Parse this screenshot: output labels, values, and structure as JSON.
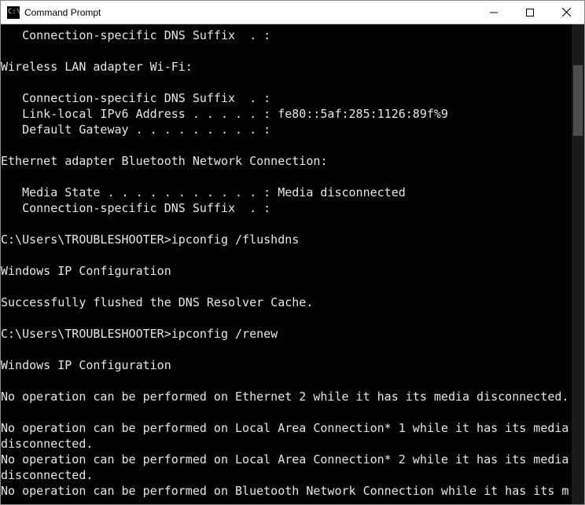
{
  "window": {
    "title": "Command Prompt"
  },
  "terminal": {
    "lines": [
      "   Connection-specific DNS Suffix  . :",
      "",
      "Wireless LAN adapter Wi-Fi:",
      "",
      "   Connection-specific DNS Suffix  . :",
      "   Link-local IPv6 Address . . . . . : fe80::5af:285:1126:89f%9",
      "   Default Gateway . . . . . . . . . :",
      "",
      "Ethernet adapter Bluetooth Network Connection:",
      "",
      "   Media State . . . . . . . . . . . : Media disconnected",
      "   Connection-specific DNS Suffix  . :",
      "",
      "C:\\Users\\TROUBLESHOOTER>ipconfig /flushdns",
      "",
      "Windows IP Configuration",
      "",
      "Successfully flushed the DNS Resolver Cache.",
      "",
      "C:\\Users\\TROUBLESHOOTER>ipconfig /renew",
      "",
      "Windows IP Configuration",
      "",
      "No operation can be performed on Ethernet 2 while it has its media disconnected.",
      "",
      "No operation can be performed on Local Area Connection* 1 while it has its media disconnected.",
      "No operation can be performed on Local Area Connection* 2 while it has its media disconnected.",
      "No operation can be performed on Bluetooth Network Connection while it has its m"
    ]
  }
}
